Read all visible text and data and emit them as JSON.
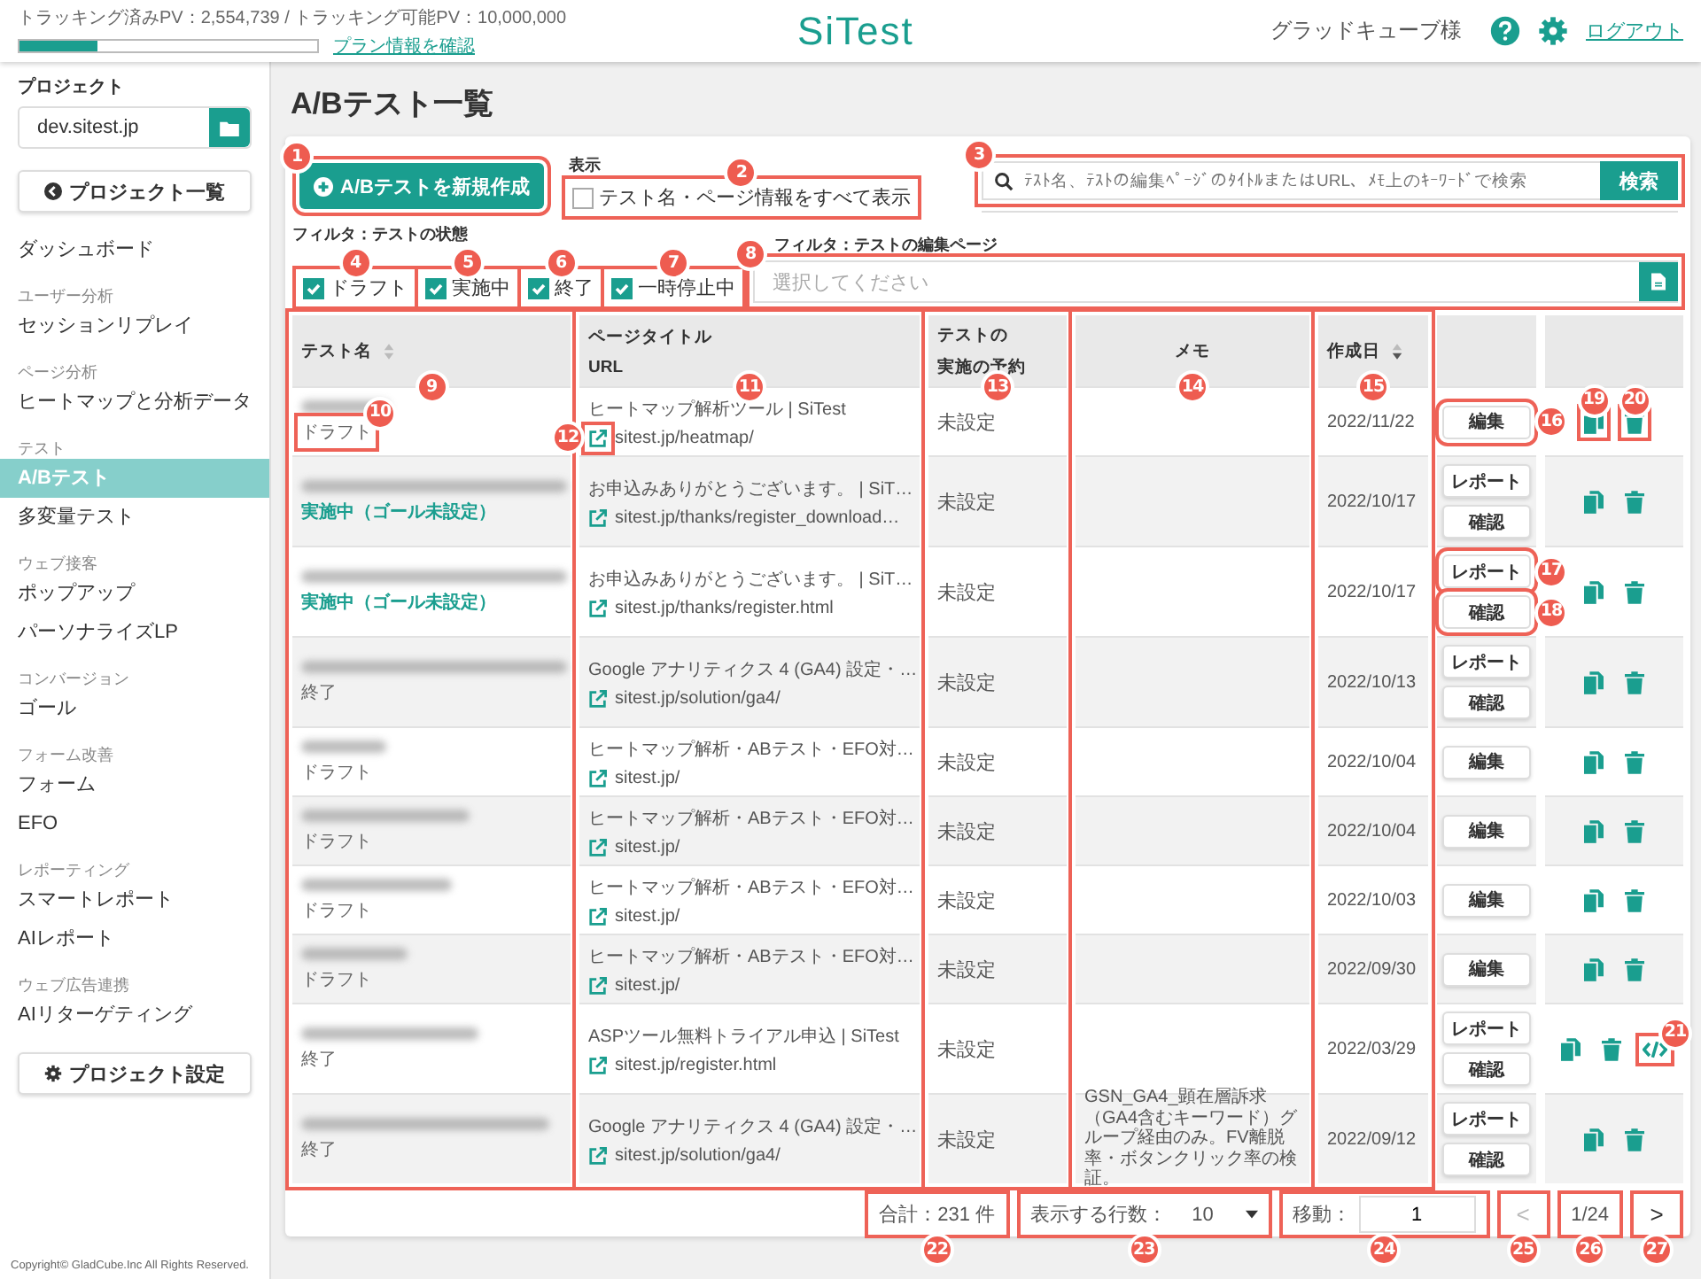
{
  "header": {
    "usage": "トラッキング済みPV：2,554,739 / トラッキング可能PV：10,000,000",
    "level": 0.26,
    "plan_link": "プラン情報を確認",
    "logo": "SiTest",
    "user": "グラッドキューブ様",
    "logout": "ログアウト"
  },
  "sidebar": {
    "project_label": "プロジェクト",
    "project": "dev.sitest.jp",
    "project_list_button": "プロジェクト一覧",
    "sections": [
      {
        "items": [
          {
            "label": "ダッシュボード",
            "selected": false
          }
        ]
      },
      {
        "heading": "ユーザー分析",
        "items": [
          {
            "label": "セッションリプレイ",
            "selected": false
          }
        ]
      },
      {
        "heading": "ページ分析",
        "items": [
          {
            "label": "ヒートマップと分析データ",
            "selected": false
          }
        ]
      },
      {
        "heading": "テスト",
        "items": [
          {
            "label": "A/Bテスト",
            "selected": true
          },
          {
            "label": "多変量テスト",
            "selected": false
          }
        ]
      },
      {
        "heading": "ウェブ接客",
        "items": [
          {
            "label": "ポップアップ",
            "selected": false
          },
          {
            "label": "パーソナライズLP",
            "selected": false
          }
        ]
      },
      {
        "heading": "コンバージョン",
        "items": [
          {
            "label": "ゴール",
            "selected": false
          }
        ]
      },
      {
        "heading": "フォーム改善",
        "items": [
          {
            "label": "フォーム",
            "selected": false
          },
          {
            "label": "EFO",
            "selected": false
          }
        ]
      },
      {
        "heading": "レポーティング",
        "items": [
          {
            "label": "スマートレポート",
            "selected": false
          },
          {
            "label": "AIレポート",
            "selected": false
          }
        ]
      },
      {
        "heading": "ウェブ広告連携",
        "items": [
          {
            "label": "AIリターゲティング",
            "selected": false
          }
        ]
      }
    ],
    "settings_button": "プロジェクト設定",
    "copyright": "Copyright© GladCube.Inc All Rights Reserved."
  },
  "main": {
    "title": "A/Bテスト一覧",
    "new_button": {
      "label": "A/Bテストを新規作成",
      "callout": "1"
    },
    "display": {
      "label": "表示",
      "checkbox": {
        "label": "テスト名・ページ情報をすべて表示",
        "checked": false,
        "callout": "2"
      }
    },
    "search": {
      "placeholder": "ﾃｽﾄ名、ﾃｽﾄの編集ﾍﾟｰｼﾞのﾀｲﾄﾙまたはURL、ﾒﾓ上のｷｰﾜｰﾄﾞで検索",
      "button": "検索",
      "callout": "3"
    },
    "status_filter": {
      "label": "フィルタ：テストの状態",
      "options": [
        {
          "label": "ドラフト",
          "checked": true,
          "callout": "4"
        },
        {
          "label": "実施中",
          "checked": true,
          "callout": "5"
        },
        {
          "label": "終了",
          "checked": true,
          "callout": "6"
        },
        {
          "label": "一時停止中",
          "checked": true,
          "callout": "7"
        }
      ]
    },
    "page_filter": {
      "label": "フィルタ：テストの編集ページ",
      "placeholder": "選択してください",
      "callout": "8"
    },
    "table": {
      "columns": [
        {
          "kind": "name",
          "label": "テスト名",
          "sortable": true,
          "sort_descending": false,
          "callout": "9"
        },
        {
          "kind": "page",
          "label": "ページタイトル",
          "sublabel": "URL",
          "callout": "11"
        },
        {
          "kind": "schedule",
          "label": "テストの",
          "sublabel": "実施の予約",
          "callout": "13"
        },
        {
          "kind": "memo",
          "label": "メモ",
          "callout": "14"
        },
        {
          "kind": "date",
          "label": "作成日",
          "sortable": true,
          "sort_descending": true,
          "callout": "15"
        }
      ],
      "rows": [
        {
          "status": {
            "text": "ドラフト",
            "kind": "draft",
            "callout": "10"
          },
          "page_title": "ヒートマップ解析ツール | SiTest",
          "url": {
            "text": "sitest.jp/heatmap/",
            "callout": "12"
          },
          "schedule": "未設定",
          "date": "2022/11/22",
          "actions": [
            {
              "label": "編集",
              "callout": "16"
            }
          ],
          "tools": [
            {
              "kind": "copy",
              "callout": "19"
            },
            {
              "kind": "delete",
              "callout": "20"
            }
          ]
        },
        {
          "status": {
            "text": "実施中（ゴール未設定）",
            "kind": "running"
          },
          "page_title": "お申込みありがとうございます。 | SiT…",
          "url": {
            "text": "sitest.jp/thanks/register_download…"
          },
          "schedule": "未設定",
          "date": "2022/10/17",
          "actions": [
            {
              "label": "レポート"
            },
            {
              "label": "確認"
            }
          ],
          "tools": [
            {
              "kind": "copy"
            },
            {
              "kind": "delete"
            }
          ]
        },
        {
          "status": {
            "text": "実施中（ゴール未設定）",
            "kind": "running"
          },
          "page_title": "お申込みありがとうございます。 | SiT…",
          "url": {
            "text": "sitest.jp/thanks/register.html"
          },
          "schedule": "未設定",
          "date": "2022/10/17",
          "actions": [
            {
              "label": "レポート",
              "callout": "17"
            },
            {
              "label": "確認",
              "callout": "18"
            }
          ],
          "tools": [
            {
              "kind": "copy"
            },
            {
              "kind": "delete"
            }
          ]
        },
        {
          "status": {
            "text": "終了",
            "kind": "ended"
          },
          "page_title": "Google アナリティクス 4 (GA4) 設定・…",
          "url": {
            "text": "sitest.jp/solution/ga4/"
          },
          "schedule": "未設定",
          "date": "2022/10/13",
          "actions": [
            {
              "label": "レポート"
            },
            {
              "label": "確認"
            }
          ],
          "tools": [
            {
              "kind": "copy"
            },
            {
              "kind": "delete"
            }
          ]
        },
        {
          "status": {
            "text": "ドラフト",
            "kind": "draft"
          },
          "page_title": "ヒートマップ解析・ABテスト・EFO対…",
          "url": {
            "text": "sitest.jp/"
          },
          "schedule": "未設定",
          "date": "2022/10/04",
          "actions": [
            {
              "label": "編集"
            }
          ],
          "tools": [
            {
              "kind": "copy"
            },
            {
              "kind": "delete"
            }
          ]
        },
        {
          "status": {
            "text": "ドラフト",
            "kind": "draft"
          },
          "page_title": "ヒートマップ解析・ABテスト・EFO対…",
          "url": {
            "text": "sitest.jp/"
          },
          "schedule": "未設定",
          "date": "2022/10/04",
          "actions": [
            {
              "label": "編集"
            }
          ],
          "tools": [
            {
              "kind": "copy"
            },
            {
              "kind": "delete"
            }
          ]
        },
        {
          "status": {
            "text": "ドラフト",
            "kind": "draft"
          },
          "page_title": "ヒートマップ解析・ABテスト・EFO対…",
          "url": {
            "text": "sitest.jp/"
          },
          "schedule": "未設定",
          "date": "2022/10/03",
          "actions": [
            {
              "label": "編集"
            }
          ],
          "tools": [
            {
              "kind": "copy"
            },
            {
              "kind": "delete"
            }
          ]
        },
        {
          "status": {
            "text": "ドラフト",
            "kind": "draft"
          },
          "page_title": "ヒートマップ解析・ABテスト・EFO対…",
          "url": {
            "text": "sitest.jp/"
          },
          "schedule": "未設定",
          "date": "2022/09/30",
          "actions": [
            {
              "label": "編集"
            }
          ],
          "tools": [
            {
              "kind": "copy"
            },
            {
              "kind": "delete"
            }
          ]
        },
        {
          "status": {
            "text": "終了",
            "kind": "ended"
          },
          "page_title": "ASPツール無料トライアル申込 | SiTest",
          "url": {
            "text": "sitest.jp/register.html"
          },
          "schedule": "未設定",
          "date": "2022/03/29",
          "actions": [
            {
              "label": "レポート"
            },
            {
              "label": "確認"
            }
          ],
          "tools": [
            {
              "kind": "copy"
            },
            {
              "kind": "delete"
            },
            {
              "kind": "code",
              "callout": "21"
            }
          ]
        },
        {
          "status": {
            "text": "終了",
            "kind": "ended"
          },
          "page_title": "Google アナリティクス 4 (GA4) 設定・…",
          "url": {
            "text": "sitest.jp/solution/ga4/"
          },
          "schedule": "未設定",
          "memo": "GSN_GA4_顕在層訴求（GA4含むキーワード）グループ経由のみ。FV離脱率・ボタンクリック率の検証。",
          "date": "2022/09/12",
          "actions": [
            {
              "label": "レポート"
            },
            {
              "label": "確認"
            }
          ],
          "tools": [
            {
              "kind": "copy"
            },
            {
              "kind": "delete"
            }
          ]
        }
      ]
    },
    "pagination": {
      "total": {
        "text": "合計：231 件",
        "callout": "22"
      },
      "rows_per_page": {
        "label": "表示する行数：",
        "value": "10",
        "callout": "23"
      },
      "jump": {
        "label": "移動：",
        "value": "1",
        "callout": "24"
      },
      "prev": {
        "text": "<",
        "disabled": true,
        "callout": "25"
      },
      "page": {
        "text": "1/24",
        "callout": "26"
      },
      "next": {
        "text": ">",
        "disabled": false,
        "callout": "27"
      }
    }
  }
}
